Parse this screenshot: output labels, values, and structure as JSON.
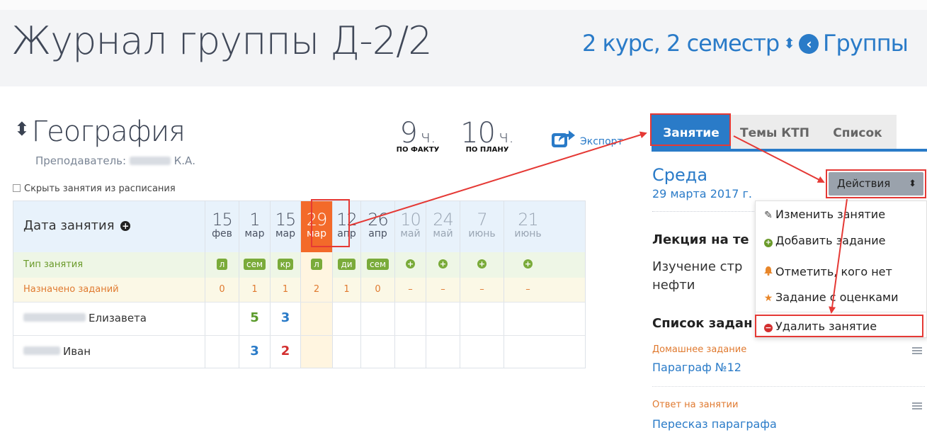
{
  "header": {
    "title": "Журнал группы Д-2/2",
    "semester_link": "2 курс, 2 семестр",
    "groups_link": "Группы"
  },
  "subject": {
    "name": "География",
    "teacher_prefix": "Преподаватель:",
    "teacher_initials": "К.А."
  },
  "hours": {
    "fact_value": "9",
    "fact_unit": "ч.",
    "fact_caption": "ПО ФАКТУ",
    "plan_value": "10",
    "plan_unit": "ч.",
    "plan_caption": "ПО ПЛАНУ"
  },
  "export_label": "Экспорт",
  "hide_lessons_label": "Скрыть занятия из расписания",
  "journal": {
    "date_header": "Дата занятия",
    "type_row_label": "Тип занятия",
    "assign_row_label": "Назначено заданий",
    "dates": [
      {
        "day": "15",
        "month": "фев"
      },
      {
        "day": "1",
        "month": "мар"
      },
      {
        "day": "15",
        "month": "мар"
      },
      {
        "day": "29",
        "month": "мар"
      },
      {
        "day": "12",
        "month": "апр"
      },
      {
        "day": "26",
        "month": "апр"
      },
      {
        "day": "10",
        "month": "май"
      },
      {
        "day": "24",
        "month": "май"
      },
      {
        "day": "7",
        "month": "июнь"
      },
      {
        "day": "21",
        "month": "июнь"
      }
    ],
    "types": [
      "л",
      "сем",
      "кр",
      "л",
      "ди",
      "сем",
      "+",
      "+",
      "+",
      "+"
    ],
    "assigned": [
      "0",
      "1",
      "1",
      "2",
      "1",
      "0",
      "–",
      "–",
      "–",
      "–"
    ],
    "students": [
      {
        "name": "Елизавета",
        "grades": [
          "",
          "5",
          "3",
          "",
          "",
          "",
          "",
          "",
          "",
          ""
        ]
      },
      {
        "name": "Иван",
        "grades": [
          "",
          "3",
          "2",
          "",
          "",
          "",
          "",
          "",
          "",
          ""
        ]
      }
    ],
    "grade_colors": {
      "5": "#5a9a2a",
      "3": "#2a7bc8",
      "2": "#d32f2f"
    }
  },
  "tabs": {
    "lesson": "Занятие",
    "ktp": "Темы КТП",
    "list": "Список"
  },
  "lesson": {
    "day_name": "Среда",
    "date": "29 марта 2017 г.",
    "title": "Лекция на те",
    "desc_line1": "Изучение стр",
    "desc_line2": "нефти"
  },
  "actions": {
    "button_label": "Действия",
    "menu": [
      {
        "icon": "pencil-icon",
        "label": "Изменить занятие"
      },
      {
        "icon": "plus-circle-icon",
        "label": "Добавить задание"
      },
      {
        "icon": "bell-icon",
        "label": "Отметить, кого нет"
      },
      {
        "icon": "star-icon",
        "label": "Задание с оценками"
      },
      {
        "icon": "minus-circle-icon",
        "label": "Удалить занятие"
      }
    ]
  },
  "tasks": {
    "title": "Список задан",
    "items": [
      {
        "kind": "Домашнее задание",
        "name": "Параграф №12"
      },
      {
        "kind": "Ответ на занятии",
        "name": "Пересказ параграфа"
      }
    ]
  },
  "colors": {
    "accent": "#2a7bc8",
    "active_date": "#f36a2a",
    "highlight": "#e53935",
    "type_badge": "#7aab3a"
  }
}
